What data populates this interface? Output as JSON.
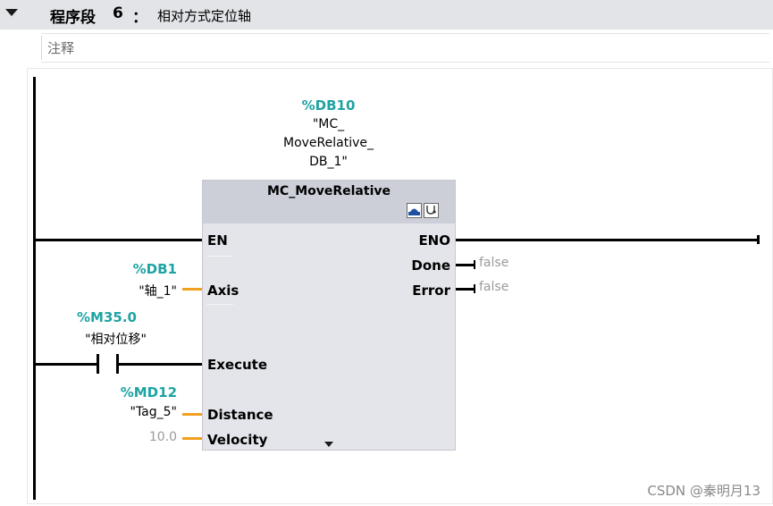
{
  "network": {
    "label": "程序段",
    "number": "6",
    "colon": "：",
    "title": "相对方式定位轴",
    "comment_placeholder": "注释"
  },
  "instance": {
    "address": "%DB10",
    "line1": "\"MC_",
    "line2": "MoveRelative_",
    "line3": "DB_1\""
  },
  "block": {
    "name": "MC_MoveRelative",
    "inputs": [
      {
        "pin": "EN"
      },
      {
        "pin": "Axis",
        "address": "%DB1",
        "symbol": "\"轴_1\""
      },
      {
        "pin": "Execute",
        "address": "%M35.0",
        "symbol": "\"相对位移\""
      },
      {
        "pin": "Distance",
        "address": "%MD12",
        "symbol": "\"Tag_5\""
      },
      {
        "pin": "Velocity",
        "value": "10.0"
      }
    ],
    "outputs": [
      {
        "pin": "ENO"
      },
      {
        "pin": "Done",
        "value": "false"
      },
      {
        "pin": "Error",
        "value": "false"
      }
    ]
  },
  "icons": {
    "collapse": "triangle-down-icon",
    "axis_button": "axis-icon",
    "diagnostics_button": "stethoscope-icon",
    "more_pins": "chevron-down-icon",
    "contact": "normally-open-contact-icon"
  },
  "colors": {
    "address": "#1fa3a3",
    "wire_orange": "#f0a020",
    "block_fill": "#e4e5ea",
    "block_header": "#ccced8"
  },
  "watermark": "CSDN @秦明月13"
}
